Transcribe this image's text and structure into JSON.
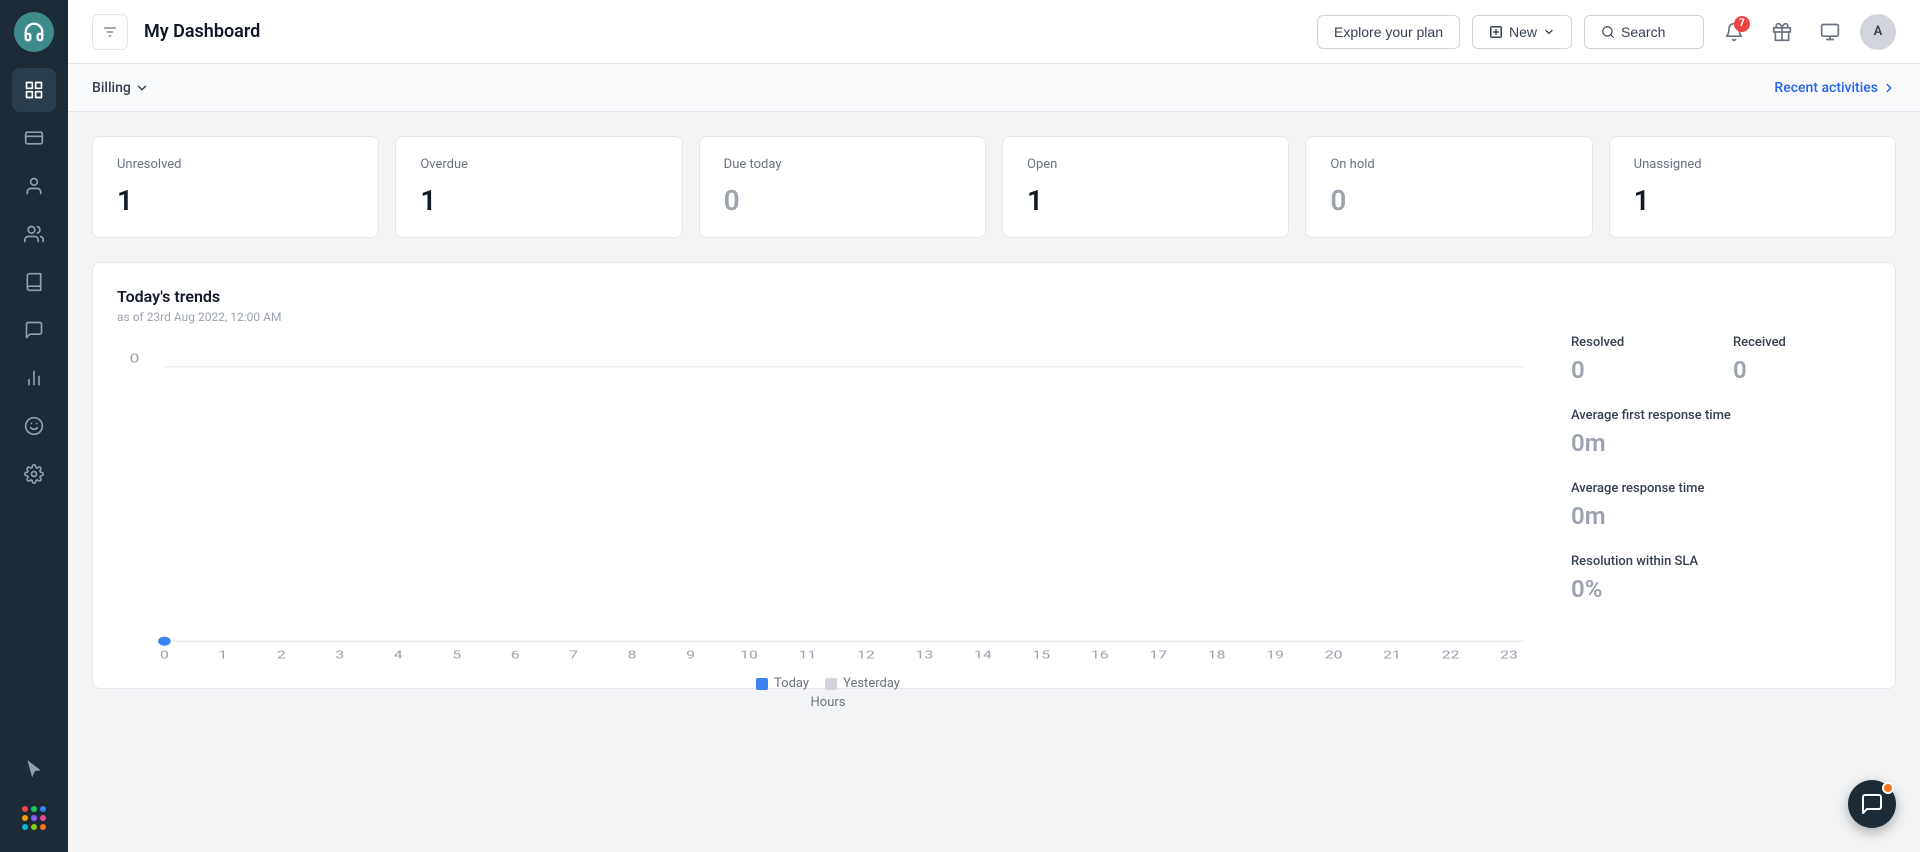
{
  "sidebar": {
    "logo_icon": "headphones-icon",
    "items": [
      {
        "name": "dashboard",
        "icon": "dashboard-icon",
        "active": true
      },
      {
        "name": "tickets",
        "icon": "ticket-icon",
        "active": false
      },
      {
        "name": "contacts",
        "icon": "contacts-icon",
        "active": false
      },
      {
        "name": "groups",
        "icon": "groups-icon",
        "active": false
      },
      {
        "name": "knowledge",
        "icon": "book-icon",
        "active": false
      },
      {
        "name": "conversations",
        "icon": "chat-icon",
        "active": false
      },
      {
        "name": "reports",
        "icon": "reports-icon",
        "active": false
      },
      {
        "name": "feedback",
        "icon": "feedback-icon",
        "active": false
      },
      {
        "name": "settings",
        "icon": "settings-icon",
        "active": false
      }
    ],
    "cursor_icon": "cursor-icon",
    "apps_icon": "apps-icon",
    "dot_colors": [
      "#ef4444",
      "#22c55e",
      "#3b82f6",
      "#f59e0b",
      "#8b5cf6",
      "#ec4899",
      "#06b6d4",
      "#84cc16",
      "#f97316"
    ]
  },
  "topbar": {
    "filter_icon": "filter-icon",
    "title": "My Dashboard",
    "explore_plan_label": "Explore your plan",
    "new_label": "New",
    "new_icon": "plus-icon",
    "search_label": "Search",
    "search_icon": "search-icon",
    "notification_icon": "bell-icon",
    "notification_count": "7",
    "gift_icon": "gift-icon",
    "help_icon": "help-icon",
    "avatar_label": "A"
  },
  "subbar": {
    "billing_label": "Billing",
    "dropdown_icon": "chevron-down-icon",
    "recent_activities_label": "Recent activities",
    "recent_activities_icon": "chevron-right-icon"
  },
  "stats": [
    {
      "label": "Unresolved",
      "value": "1",
      "is_zero": false
    },
    {
      "label": "Overdue",
      "value": "1",
      "is_zero": false
    },
    {
      "label": "Due today",
      "value": "0",
      "is_zero": true
    },
    {
      "label": "Open",
      "value": "1",
      "is_zero": false
    },
    {
      "label": "On hold",
      "value": "0",
      "is_zero": true
    },
    {
      "label": "Unassigned",
      "value": "1",
      "is_zero": false
    }
  ],
  "trends": {
    "title": "Today's trends",
    "subtitle": "as of 23rd Aug 2022, 12:00 AM",
    "x_labels": [
      "0",
      "1",
      "2",
      "3",
      "4",
      "5",
      "6",
      "7",
      "8",
      "9",
      "10",
      "11",
      "12",
      "13",
      "14",
      "15",
      "16",
      "17",
      "18",
      "19",
      "20",
      "21",
      "22",
      "23"
    ],
    "y_label": "0",
    "x_axis_label": "Hours",
    "legend": [
      {
        "label": "Today",
        "color": "#3b82f6"
      },
      {
        "label": "Yesterday",
        "color": "#d1d5db"
      }
    ],
    "chart_line_y": 0,
    "stats": [
      {
        "label": "Resolved",
        "value": "0"
      },
      {
        "label": "Received",
        "value": "0"
      },
      {
        "label": "Average first response time",
        "value": "0m"
      },
      {
        "label": "Average response time",
        "value": "0m"
      },
      {
        "label": "Resolution within SLA",
        "value": "0%"
      }
    ]
  },
  "chat_bubble": {
    "icon": "chat-bubble-icon",
    "has_notification": true
  }
}
